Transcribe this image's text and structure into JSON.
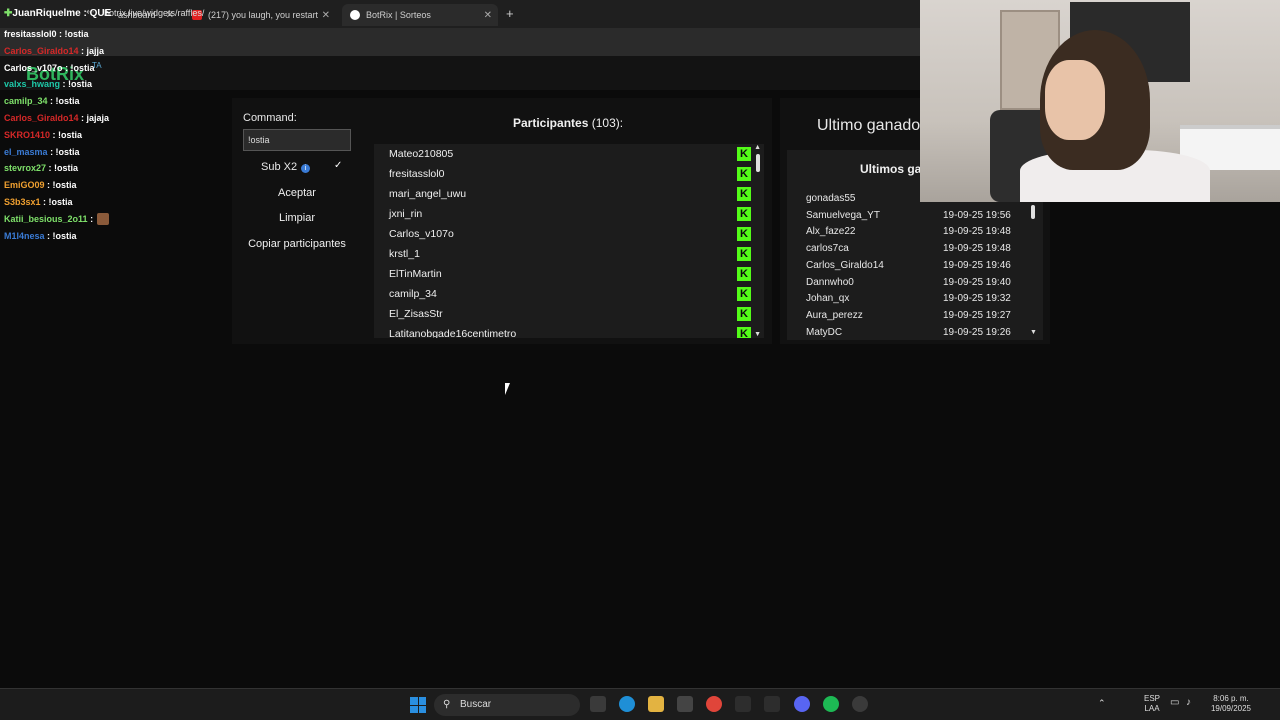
{
  "browser": {
    "tabs": [
      {
        "label": "ashboard",
        "active": false
      },
      {
        "label": "(217) you laugh, you restart - Yo",
        "active": false
      },
      {
        "label": "BotRix | Sorteos",
        "active": true
      }
    ],
    "url": "botrix.live/widgets/raffles/"
  },
  "stream_overlay": {
    "title": "JuanRiquelme : QUE"
  },
  "site": {
    "logo": "BotRix",
    "logo_suffix": "TA"
  },
  "chat": [
    {
      "user": "fresitasslol0",
      "msg": ": !ostia",
      "color": "#ffffff"
    },
    {
      "user": "Carlos_Giraldo14",
      "msg": ": jajja",
      "color": "#d62828"
    },
    {
      "user": "Carlos_v107o",
      "msg": ": !ostia",
      "color": "#ffffff"
    },
    {
      "user": "valxs_hwang",
      "msg": ": !ostia",
      "color": "#1ec8a8"
    },
    {
      "user": "camilp_34",
      "msg": ": !ostia",
      "color": "#7ee06a"
    },
    {
      "user": "Carlos_Giraldo14",
      "msg": ": jajaja",
      "color": "#d62828"
    },
    {
      "user": "SKRO1410",
      "msg": ": !ostia",
      "color": "#d62828"
    },
    {
      "user": "el_masma",
      "msg": ": !ostia",
      "color": "#3a7bd5"
    },
    {
      "user": "stevrox27",
      "msg": ": !ostia",
      "color": "#7ee06a"
    },
    {
      "user": "EmiGO09",
      "msg": ": !ostia",
      "color": "#f0a030"
    },
    {
      "user": "S3b3sx1",
      "msg": ": !ostia",
      "color": "#f0a030"
    },
    {
      "user": "Katii_besious_2o11",
      "msg": ":",
      "color": "#7ee06a"
    },
    {
      "user": "M1l4nesa",
      "msg": ": !ostia",
      "color": "#3a7bd5"
    }
  ],
  "raffle": {
    "command_label": "Command:",
    "command_value": "!ostia",
    "sub_label": "Sub X2",
    "sub_checked": "✓",
    "accept_label": "Aceptar",
    "clear_label": "Limpiar",
    "copy_label": "Copiar participantes",
    "participants_title": "Participantes",
    "participants_count": "(103):",
    "participants": [
      "Mateo210805",
      "fresitasslol0",
      "mari_angel_uwu",
      "jxni_rin",
      "Carlos_v107o",
      "krstl_1",
      "ElTinMartin",
      "camilp_34",
      "El_ZisasStr",
      "Latitanobgade16centimetro"
    ],
    "platform_icon": "K"
  },
  "winners": {
    "last_winner_title": "Ultimo ganado",
    "list_title": "Ultimos ga",
    "rows": [
      {
        "name": "gonadas55",
        "date": ""
      },
      {
        "name": "Samuelvega_YT",
        "date": "19-09-25 19:56"
      },
      {
        "name": "Alx_faze22",
        "date": "19-09-25 19:48"
      },
      {
        "name": "carlos7ca",
        "date": "19-09-25 19:48"
      },
      {
        "name": "Carlos_Giraldo14",
        "date": "19-09-25 19:46"
      },
      {
        "name": "Dannwho0",
        "date": "19-09-25 19:40"
      },
      {
        "name": "Johan_qx",
        "date": "19-09-25 19:32"
      },
      {
        "name": "Aura_perezz",
        "date": "19-09-25 19:27"
      },
      {
        "name": "MatyDC",
        "date": "19-09-25 19:26"
      }
    ]
  },
  "taskbar": {
    "search_placeholder": "Buscar",
    "lang": "ESP",
    "lang2": "LAA",
    "time": "8:06 p. m.",
    "date": "19/09/2025"
  }
}
